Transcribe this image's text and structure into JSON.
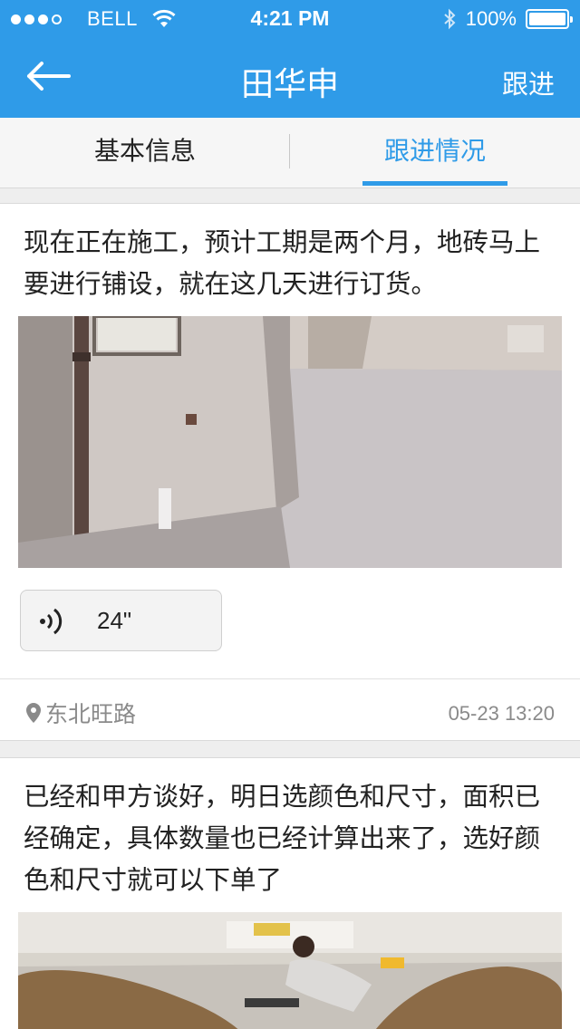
{
  "status_bar": {
    "carrier": "BELL",
    "time": "4:21 PM",
    "battery": "100%"
  },
  "nav": {
    "title": "田华申",
    "action": "跟进",
    "back_icon": "back-arrow-icon"
  },
  "tabs": [
    {
      "label": "基本信息",
      "active": false
    },
    {
      "label": "跟进情况",
      "active": true
    }
  ],
  "posts": [
    {
      "text": "现在正在施工，预计工期是两个月，地砖马上要进行铺设，就在这几天进行订货。",
      "voice": {
        "duration": "24\""
      },
      "location": "东北旺路",
      "time": "05-23 13:20"
    },
    {
      "text": "已经和甲方谈好，明日选颜色和尺寸，面积已经确定，具体数量也已经计算出来了，选好颜色和尺寸就可以下单了"
    }
  ],
  "colors": {
    "accent": "#2f9be8",
    "background": "#eeeeee",
    "muted_text": "#8a8a8a"
  }
}
